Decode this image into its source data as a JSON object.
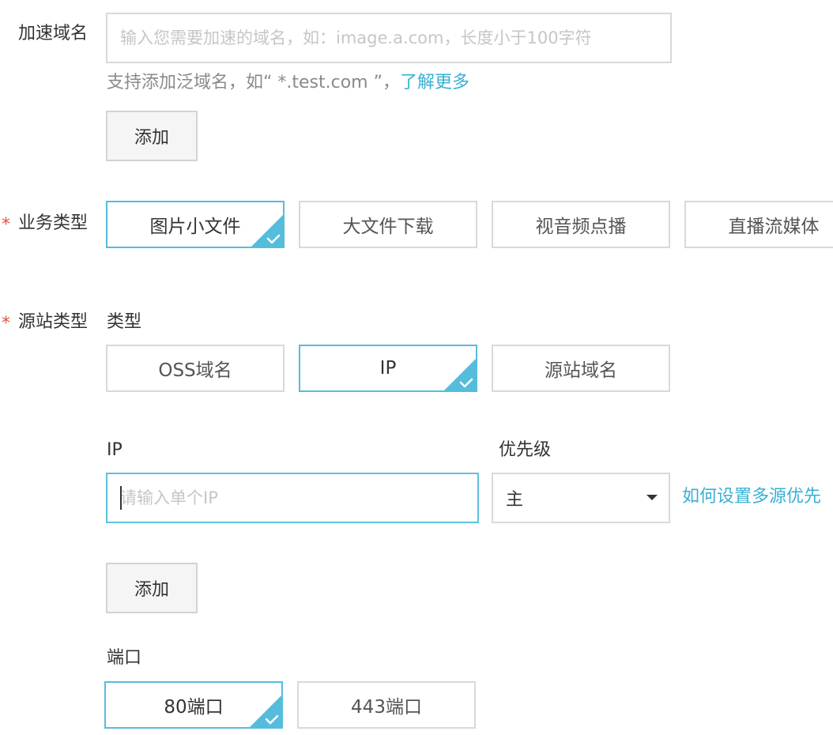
{
  "domain_section": {
    "label": "加速域名",
    "input_placeholder": "输入您需要加速的域名，如：image.a.com，长度小于100字符",
    "input_value": "",
    "hint": "支持添加泛域名，如“ *.test.com ”，",
    "hint_link": "了解更多",
    "add_button": "添加"
  },
  "business_type": {
    "required_mark": "*",
    "label": "业务类型",
    "options": [
      {
        "label": "图片小文件",
        "selected": true
      },
      {
        "label": "大文件下载",
        "selected": false
      },
      {
        "label": "视音频点播",
        "selected": false
      },
      {
        "label": "直播流媒体",
        "selected": false
      }
    ]
  },
  "origin_type": {
    "required_mark": "*",
    "label": "源站类型",
    "type_label": "类型",
    "options": [
      {
        "label": "OSS域名",
        "selected": false
      },
      {
        "label": "IP",
        "selected": true
      },
      {
        "label": "源站域名",
        "selected": false
      }
    ],
    "ip_label": "IP",
    "ip_placeholder": "请输入单个IP",
    "ip_value": "",
    "priority_label": "优先级",
    "priority_value": "主",
    "priority_help_link": "如何设置多源优先",
    "add_button": "添加",
    "port_label": "端口",
    "port_options": [
      {
        "label": "80端口",
        "selected": true
      },
      {
        "label": "443端口",
        "selected": false
      }
    ]
  },
  "colors": {
    "accent": "#55bddb",
    "link": "#39b1d4",
    "required": "#e0553a",
    "check": "#ffffff"
  }
}
